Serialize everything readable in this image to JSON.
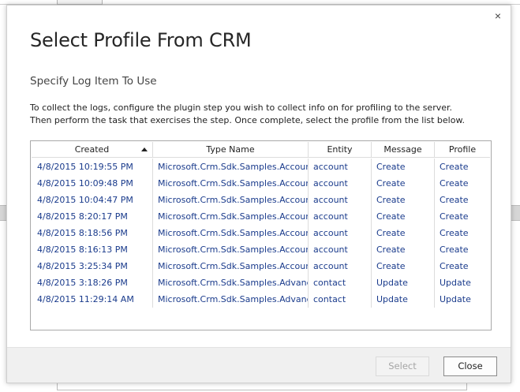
{
  "dialog": {
    "title": "Select Profile From CRM",
    "subtitle": "Specify Log Item To Use",
    "instructions": "To collect the logs, configure the plugin step you wish to collect info on for profiling to the server. Then perform the task that exercises the step. Once complete, select the profile from the list below.",
    "close_glyph": "×"
  },
  "grid": {
    "sort_column": "Created",
    "sort_direction": "ascending",
    "columns": {
      "created": "Created",
      "type_name": "Type Name",
      "entity": "Entity",
      "message": "Message",
      "profile": "Profile"
    },
    "rows": [
      {
        "created": "4/8/2015 10:19:55 PM",
        "type_name": "Microsoft.Crm.Sdk.Samples.Account",
        "entity": "account",
        "message": "Create",
        "profile": "Create"
      },
      {
        "created": "4/8/2015 10:09:48 PM",
        "type_name": "Microsoft.Crm.Sdk.Samples.Account",
        "entity": "account",
        "message": "Create",
        "profile": "Create"
      },
      {
        "created": "4/8/2015 10:04:47 PM",
        "type_name": "Microsoft.Crm.Sdk.Samples.Account",
        "entity": "account",
        "message": "Create",
        "profile": "Create"
      },
      {
        "created": "4/8/2015 8:20:17 PM",
        "type_name": "Microsoft.Crm.Sdk.Samples.Account",
        "entity": "account",
        "message": "Create",
        "profile": "Create"
      },
      {
        "created": "4/8/2015 8:18:56 PM",
        "type_name": "Microsoft.Crm.Sdk.Samples.Account",
        "entity": "account",
        "message": "Create",
        "profile": "Create"
      },
      {
        "created": "4/8/2015 8:16:13 PM",
        "type_name": "Microsoft.Crm.Sdk.Samples.Account",
        "entity": "account",
        "message": "Create",
        "profile": "Create"
      },
      {
        "created": "4/8/2015 3:25:34 PM",
        "type_name": "Microsoft.Crm.Sdk.Samples.Account",
        "entity": "account",
        "message": "Create",
        "profile": "Create"
      },
      {
        "created": "4/8/2015 3:18:26 PM",
        "type_name": "Microsoft.Crm.Sdk.Samples.Advance",
        "entity": "contact",
        "message": "Update",
        "profile": "Update"
      },
      {
        "created": "4/8/2015 11:29:14 AM",
        "type_name": "Microsoft.Crm.Sdk.Samples.Advance",
        "entity": "contact",
        "message": "Update",
        "profile": "Update"
      }
    ]
  },
  "footer": {
    "select_label": "Select",
    "close_label": "Close"
  },
  "colors": {
    "link_text": "#1a3b8c",
    "footer_bg": "#f0f0f0",
    "disabled_text": "#a5a5a5"
  }
}
